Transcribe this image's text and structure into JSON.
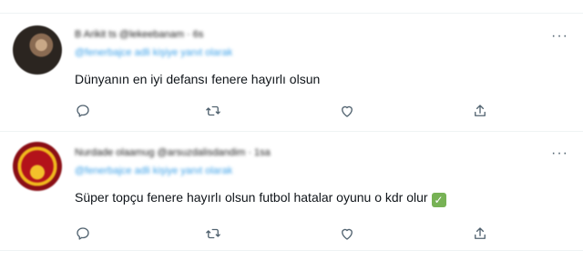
{
  "tweets": [
    {
      "author_line": "B Arikit ts @lekeebanam · 6s",
      "reply_line": "@fenerbajce adli kişiye yanıt olarak",
      "text": "Dünyanın en iyi defansı fenere hayırlı olsun",
      "emoji": "",
      "avatar_icon": "profile-photo",
      "more_label": "···"
    },
    {
      "author_line": "Nurdade olaamug @arsuzdalisdandim · 1sa",
      "reply_line": "@fenerbajce adli kişiye yanıt olarak",
      "text": "Süper topçu fenere hayırlı olsun futbol hatalar oyunu o kdr olur",
      "emoji": "✓",
      "avatar_icon": "galatasaray-logo",
      "more_label": "···"
    }
  ],
  "action_icons": [
    "reply-icon",
    "retweet-icon",
    "like-icon",
    "share-icon"
  ],
  "colors": {
    "text": "#0f1419",
    "secondary": "#536471",
    "link": "#1d9bf0",
    "check": "#77b255"
  }
}
